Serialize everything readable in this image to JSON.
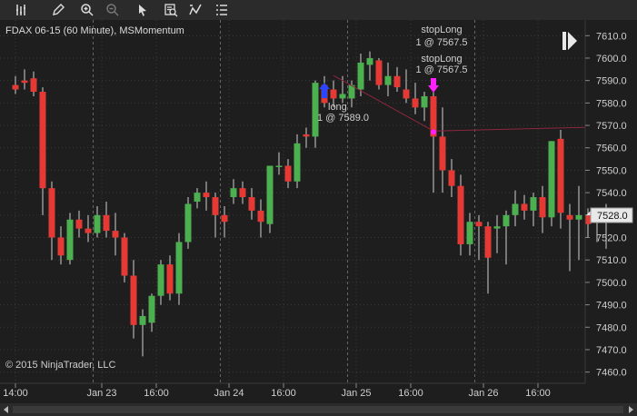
{
  "toolbar": {
    "icons": [
      "bar-chart-icon",
      "pencil-icon",
      "zoom-in-icon",
      "zoom-out-icon",
      "pointer-icon",
      "data-box-icon",
      "indicator-icon",
      "list-icon"
    ]
  },
  "chart_data": {
    "type": "candlestick",
    "title": "FDAX 06-15 (60 Minute), MSMomentum",
    "copyright": "© 2015 NinjaTrader, LLC",
    "ylim": [
      7455,
      7617
    ],
    "y_ticks": [
      7460.0,
      7470.0,
      7480.0,
      7490.0,
      7500.0,
      7510.0,
      7520.0,
      7530.0,
      7540.0,
      7550.0,
      7560.0,
      7570.0,
      7580.0,
      7590.0,
      7600.0,
      7610.0
    ],
    "x_ticks": [
      {
        "label": "14:00",
        "bar": 0
      },
      {
        "label": "Jan 23",
        "bar": 9.5
      },
      {
        "label": "16:00",
        "bar": 15.5
      },
      {
        "label": "Jan 24",
        "bar": 23.5
      },
      {
        "label": "16:00",
        "bar": 29.5
      },
      {
        "label": "Jan 25",
        "bar": 37.5
      },
      {
        "label": "16:00",
        "bar": 43.5
      },
      {
        "label": "Jan 26",
        "bar": 51.5
      },
      {
        "label": "16:00",
        "bar": 57.5
      }
    ],
    "day_separators": [
      8,
      22,
      36,
      50
    ],
    "candles": [
      [
        7588,
        7592,
        7584,
        7586
      ],
      [
        7590,
        7595,
        7586,
        7589
      ],
      [
        7591,
        7594,
        7583,
        7585
      ],
      [
        7585,
        7587,
        7530,
        7542
      ],
      [
        7542,
        7545,
        7510,
        7520
      ],
      [
        7520,
        7525,
        7508,
        7512
      ],
      [
        7510,
        7531,
        7508,
        7528
      ],
      [
        7528,
        7532,
        7520,
        7524
      ],
      [
        7524,
        7530,
        7518,
        7522
      ],
      [
        7522,
        7534,
        7520,
        7530
      ],
      [
        7530,
        7536,
        7520,
        7523
      ],
      [
        7523,
        7531,
        7512,
        7520
      ],
      [
        7520,
        7522,
        7500,
        7503
      ],
      [
        7503,
        7510,
        7475,
        7481
      ],
      [
        7481,
        7488,
        7467,
        7485
      ],
      [
        7482,
        7495,
        7478,
        7494
      ],
      [
        7494,
        7510,
        7490,
        7508
      ],
      [
        7508,
        7512,
        7492,
        7495
      ],
      [
        7495,
        7522,
        7490,
        7518
      ],
      [
        7518,
        7538,
        7515,
        7535
      ],
      [
        7536,
        7542,
        7533,
        7540
      ],
      [
        7540,
        7545,
        7532,
        7538
      ],
      [
        7538,
        7540,
        7520,
        7530
      ],
      [
        7530,
        7534,
        7520,
        7527
      ],
      [
        7538,
        7546,
        7535,
        7542
      ],
      [
        7542,
        7545,
        7535,
        7538
      ],
      [
        7538,
        7542,
        7528,
        7532
      ],
      [
        7532,
        7537,
        7520,
        7527
      ],
      [
        7526,
        7545,
        7522,
        7552
      ],
      [
        7552,
        7558,
        7548,
        7552
      ],
      [
        7552,
        7555,
        7542,
        7545
      ],
      [
        7545,
        7566,
        7542,
        7562
      ],
      [
        7566,
        7569,
        7560,
        7565
      ],
      [
        7565,
        7590,
        7560,
        7589
      ],
      [
        7588,
        7592,
        7578,
        7580
      ],
      [
        7586,
        7590,
        7578,
        7582
      ],
      [
        7582,
        7592,
        7580,
        7584
      ],
      [
        7582,
        7590,
        7578,
        7588
      ],
      [
        7586,
        7602,
        7583,
        7598
      ],
      [
        7597,
        7603,
        7590,
        7600
      ],
      [
        7599,
        7600,
        7586,
        7588
      ],
      [
        7588,
        7598,
        7583,
        7592
      ],
      [
        7592,
        7596,
        7585,
        7587
      ],
      [
        7586,
        7595,
        7580,
        7582
      ],
      [
        7582,
        7589,
        7575,
        7578
      ],
      [
        7578,
        7585,
        7572,
        7583
      ],
      [
        7583,
        7590,
        7540,
        7565
      ],
      [
        7565,
        7578,
        7540,
        7550
      ],
      [
        7550,
        7555,
        7538,
        7543
      ],
      [
        7543,
        7548,
        7512,
        7517
      ],
      [
        7517,
        7531,
        7512,
        7527
      ],
      [
        7527,
        7530,
        7510,
        7525
      ],
      [
        7525,
        7527,
        7495,
        7511
      ],
      [
        7524,
        7530,
        7513,
        7525
      ],
      [
        7525,
        7532,
        7508,
        7530
      ],
      [
        7530,
        7541,
        7525,
        7535
      ],
      [
        7535,
        7539,
        7528,
        7532
      ],
      [
        7532,
        7540,
        7525,
        7538
      ],
      [
        7538,
        7543,
        7522,
        7529
      ],
      [
        7529,
        7563,
        7525,
        7563
      ],
      [
        7564,
        7568,
        7524,
        7531
      ],
      [
        7530,
        7535,
        7505,
        7528
      ],
      [
        7528,
        7543,
        7510,
        7530
      ],
      [
        7530,
        7533,
        7520,
        7526
      ],
      [
        7530,
        7532,
        7518,
        7527
      ],
      [
        7530,
        7535,
        7515,
        7527
      ]
    ],
    "price_marker": {
      "value": 7528.0,
      "label": "7528.0"
    },
    "trades": [
      {
        "type": "long",
        "bar": 34,
        "price": 7589.0,
        "label1": "long",
        "label2": "1 @ 7589.0"
      },
      {
        "type": "stopLong",
        "bar": 46,
        "price": 7567.5,
        "label1": "stopLong",
        "label2": "1 @ 7567.5"
      },
      {
        "type": "stopLong",
        "bar": 46,
        "price": 7567.5,
        "label1": "stopLong",
        "label2": "1 @ 7567.5"
      }
    ],
    "colors": {
      "up": "#4caf50",
      "down": "#e53935",
      "wick": "#d0d0d0",
      "trade_line": "#8e2640",
      "entry": "#2a46ff",
      "exit": "#ff22ff"
    }
  }
}
